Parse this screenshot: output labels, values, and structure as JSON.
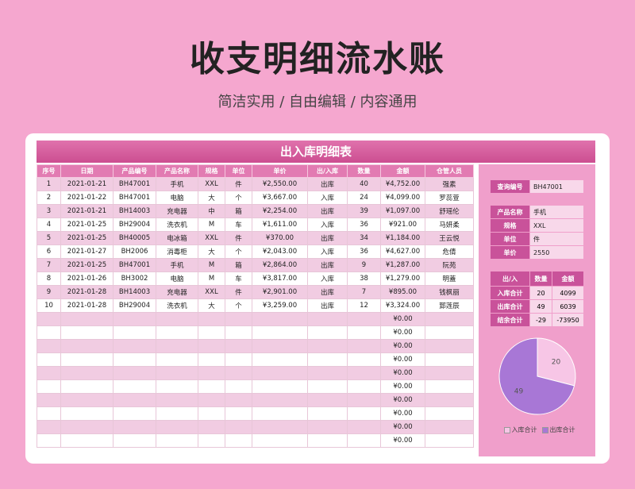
{
  "page": {
    "title": "收支明细流水账",
    "subtitle": "简洁实用 / 自由编辑 / 内容通用"
  },
  "sheet": {
    "header": "出入库明细表",
    "columns": [
      "序号",
      "日期",
      "产品编号",
      "产品名称",
      "规格",
      "单位",
      "单价",
      "出/入库",
      "数量",
      "金额",
      "仓管人员"
    ],
    "rows": [
      [
        "1",
        "2021-01-21",
        "BH47001",
        "手机",
        "XXL",
        "件",
        "¥2,550.00",
        "出库",
        "40",
        "¥4,752.00",
        "强素"
      ],
      [
        "2",
        "2021-01-22",
        "BH47001",
        "电脑",
        "大",
        "个",
        "¥3,667.00",
        "入库",
        "24",
        "¥4,099.00",
        "罗蕊萱"
      ],
      [
        "3",
        "2021-01-21",
        "BH14003",
        "充电器",
        "中",
        "箱",
        "¥2,254.00",
        "出库",
        "39",
        "¥1,097.00",
        "舒瑶伦"
      ],
      [
        "4",
        "2021-01-25",
        "BH29004",
        "洗衣机",
        "M",
        "车",
        "¥1,611.00",
        "入库",
        "36",
        "¥921.00",
        "马妍柔"
      ],
      [
        "5",
        "2021-01-25",
        "BH40005",
        "电冰箱",
        "XXL",
        "件",
        "¥370.00",
        "出库",
        "34",
        "¥1,184.00",
        "王云悦"
      ],
      [
        "6",
        "2021-01-27",
        "BH2006",
        "消毒柜",
        "大",
        "个",
        "¥2,043.00",
        "入库",
        "36",
        "¥4,627.00",
        "危倩"
      ],
      [
        "7",
        "2021-01-25",
        "BH47001",
        "手机",
        "M",
        "箱",
        "¥2,864.00",
        "出库",
        "9",
        "¥1,287.00",
        "阮苑"
      ],
      [
        "8",
        "2021-01-26",
        "BH3002",
        "电脑",
        "M",
        "车",
        "¥3,817.00",
        "入库",
        "38",
        "¥1,279.00",
        "明蓋"
      ],
      [
        "9",
        "2021-01-28",
        "BH14003",
        "充电器",
        "XXL",
        "件",
        "¥2,901.00",
        "出库",
        "7",
        "¥895.00",
        "钱枫丽"
      ],
      [
        "10",
        "2021-01-28",
        "BH29004",
        "洗衣机",
        "大",
        "个",
        "¥3,259.00",
        "出库",
        "12",
        "¥3,324.00",
        "郅莲辰"
      ]
    ],
    "empty_amount": "¥0.00",
    "empty_row_count": 10
  },
  "query": {
    "label": "查询编号",
    "value": "BH47001"
  },
  "product": [
    {
      "label": "产品名称",
      "value": "手机"
    },
    {
      "label": "规格",
      "value": "XXL"
    },
    {
      "label": "单位",
      "value": "件"
    },
    {
      "label": "单价",
      "value": "2550"
    }
  ],
  "summary": {
    "headers": [
      "出/入",
      "数量",
      "金额"
    ],
    "rows": [
      [
        "入库合计",
        "20",
        "4099"
      ],
      [
        "出库合计",
        "49",
        "6039"
      ],
      [
        "结余合计",
        "-29",
        "-73950"
      ]
    ]
  },
  "chart_data": {
    "type": "pie",
    "slices": [
      {
        "name": "入库合计",
        "value": 20,
        "color": "#f7c6e6"
      },
      {
        "name": "出库合计",
        "value": 49,
        "color": "#a877d6"
      }
    ]
  },
  "colors": {
    "accent": "#d6559a",
    "row_alt": "#f1cce2",
    "side_bg": "#f09fcb"
  }
}
